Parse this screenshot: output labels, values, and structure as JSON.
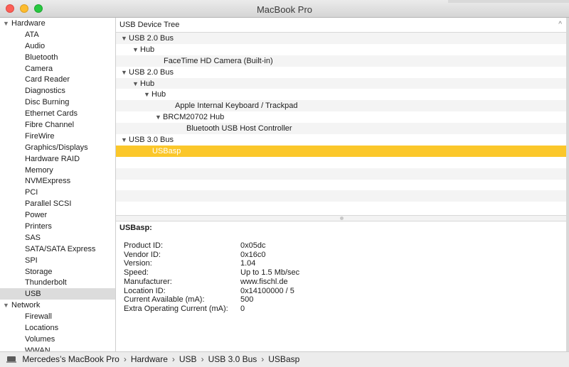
{
  "window": {
    "title": "MacBook Pro"
  },
  "sidebar": {
    "groups": [
      {
        "label": "Hardware",
        "items": [
          "ATA",
          "Audio",
          "Bluetooth",
          "Camera",
          "Card Reader",
          "Diagnostics",
          "Disc Burning",
          "Ethernet Cards",
          "Fibre Channel",
          "FireWire",
          "Graphics/Displays",
          "Hardware RAID",
          "Memory",
          "NVMExpress",
          "PCI",
          "Parallel SCSI",
          "Power",
          "Printers",
          "SAS",
          "SATA/SATA Express",
          "SPI",
          "Storage",
          "Thunderbolt",
          "USB"
        ]
      },
      {
        "label": "Network",
        "items": [
          "Firewall",
          "Locations",
          "Volumes",
          "WWAN"
        ]
      }
    ],
    "selected": "USB"
  },
  "tree": {
    "header": "USB Device Tree",
    "rows": [
      {
        "label": "USB 2.0 Bus",
        "level": 0,
        "expanded": true
      },
      {
        "label": "Hub",
        "level": 1,
        "expanded": true
      },
      {
        "label": "FaceTime HD Camera (Built-in)",
        "level": 2
      },
      {
        "label": "USB 2.0 Bus",
        "level": 0,
        "expanded": true
      },
      {
        "label": "Hub",
        "level": 1,
        "expanded": true
      },
      {
        "label": "Hub",
        "level": 2,
        "expanded": true
      },
      {
        "label": "Apple Internal Keyboard / Trackpad",
        "level": 3
      },
      {
        "label": "BRCM20702 Hub",
        "level": 3,
        "expanded": true
      },
      {
        "label": "Bluetooth USB Host Controller",
        "level": 4
      },
      {
        "label": "USB 3.0 Bus",
        "level": 0,
        "expanded": true
      },
      {
        "label": "USBasp",
        "level": 1,
        "selected": true
      }
    ],
    "empty_rows": 5
  },
  "detail": {
    "title": "USBasp:",
    "properties": [
      {
        "key": "Product ID:",
        "value": "0x05dc"
      },
      {
        "key": "Vendor ID:",
        "value": "0x16c0"
      },
      {
        "key": "Version:",
        "value": "1.04"
      },
      {
        "key": "Speed:",
        "value": "Up to 1.5 Mb/sec"
      },
      {
        "key": "Manufacturer:",
        "value": "www.fischl.de"
      },
      {
        "key": "Location ID:",
        "value": "0x14100000 / 5"
      },
      {
        "key": "Current Available (mA):",
        "value": "500"
      },
      {
        "key": "Extra Operating Current (mA):",
        "value": "0"
      }
    ]
  },
  "statusbar": {
    "crumbs": [
      "Mercedes’s MacBook Pro",
      "Hardware",
      "USB",
      "USB 3.0 Bus",
      "USBasp"
    ]
  },
  "colors": {
    "selection": "#fbc72a",
    "sidebar_selection": "#dcdcdc"
  }
}
